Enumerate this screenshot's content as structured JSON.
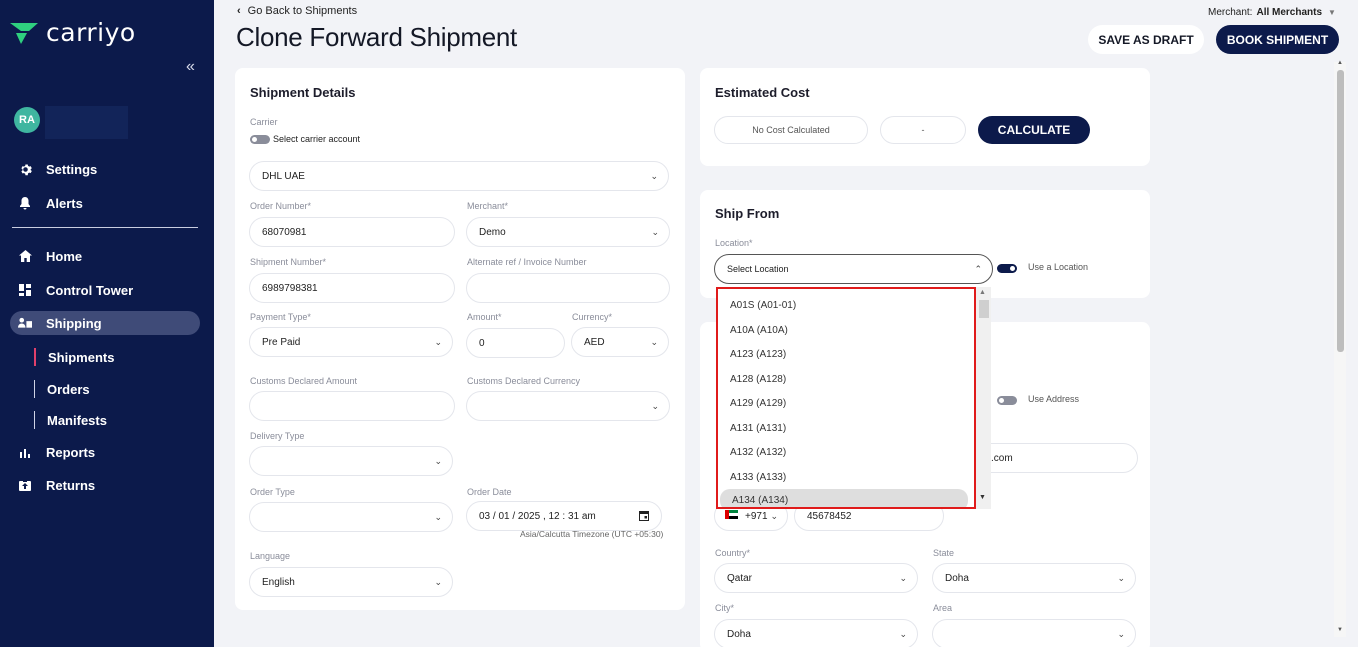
{
  "brand": {
    "name": "carriyo"
  },
  "user": {
    "initials": "RA"
  },
  "sidebar": {
    "top_items": [
      {
        "label": "Settings"
      },
      {
        "label": "Alerts"
      }
    ],
    "items": [
      {
        "label": "Home"
      },
      {
        "label": "Control Tower"
      },
      {
        "label": "Shipping"
      }
    ],
    "shipping_sub": [
      {
        "label": "Shipments"
      },
      {
        "label": "Orders"
      },
      {
        "label": "Manifests"
      }
    ],
    "bottom_items": [
      {
        "label": "Reports"
      },
      {
        "label": "Returns"
      }
    ]
  },
  "header": {
    "back_label": "Go Back to Shipments",
    "title": "Clone Forward Shipment",
    "merchant_label": "Merchant:",
    "merchant_value": "All Merchants",
    "save_draft": "SAVE AS DRAFT",
    "book": "BOOK SHIPMENT"
  },
  "shipment_details": {
    "title": "Shipment Details",
    "carrier_label": "Carrier",
    "carrier_toggle": "Select carrier account",
    "carrier_value": "DHL UAE",
    "order_number_label": "Order Number*",
    "order_number": "68070981",
    "merchant_label": "Merchant*",
    "merchant": "Demo",
    "shipment_number_label": "Shipment Number*",
    "shipment_number": "6989798381",
    "alt_ref_label": "Alternate ref / Invoice Number",
    "payment_type_label": "Payment Type*",
    "payment_type": "Pre Paid",
    "amount_label": "Amount*",
    "amount": "0",
    "currency_label": "Currency*",
    "currency": "AED",
    "customs_amount_label": "Customs Declared Amount",
    "customs_currency_label": "Customs Declared Currency",
    "delivery_type_label": "Delivery Type",
    "order_type_label": "Order Type",
    "order_date_label": "Order Date",
    "order_date": "03 / 01 / 2025 , 12 : 31   am",
    "timezone": "Asia/Calcutta Timezone (UTC +05:30)",
    "language_label": "Language",
    "language": "English"
  },
  "estimated_cost": {
    "title": "Estimated Cost",
    "no_cost": "No Cost Calculated",
    "dash": "-",
    "calculate": "CALCULATE"
  },
  "ship_from": {
    "title": "Ship From",
    "location_label": "Location*",
    "location_placeholder": "Select Location",
    "use_location": "Use a Location",
    "options": [
      {
        "label": "A01S (A01-01)"
      },
      {
        "label": "A10A (A10A)"
      },
      {
        "label": "A123 (A123)"
      },
      {
        "label": "A128 (A128)"
      },
      {
        "label": "A129 (A129)"
      },
      {
        "label": "A131 (A131)"
      },
      {
        "label": "A132 (A132)"
      },
      {
        "label": "A133 (A133)"
      },
      {
        "label": "A134 (A134)"
      }
    ]
  },
  "ship_to": {
    "use_address": "Use Address",
    "email_suffix": ".com",
    "phone_code": "+971",
    "phone": "45678452",
    "country_label": "Country*",
    "country": "Qatar",
    "state_label": "State",
    "state": "Doha",
    "city_label": "City*",
    "city": "Doha",
    "area_label": "Area"
  }
}
